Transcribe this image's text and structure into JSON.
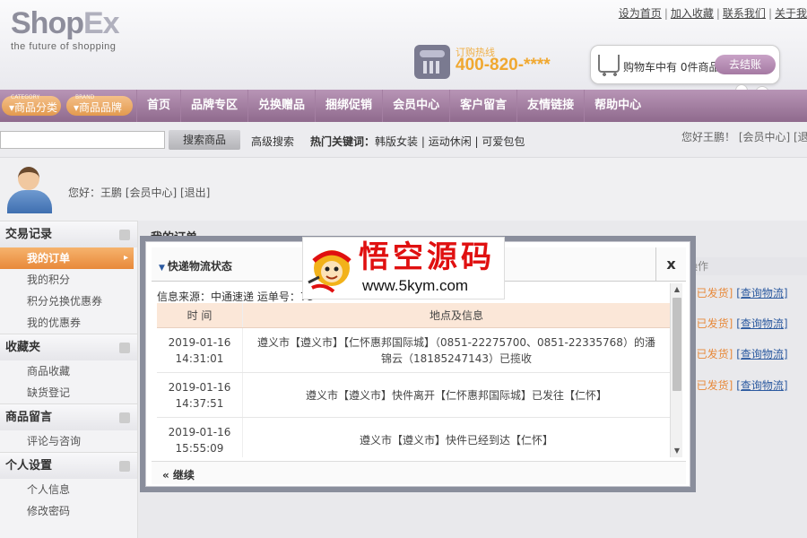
{
  "header": {
    "logo": {
      "main": "Shop",
      "accent": "Ex",
      "tagline": "the future of shopping"
    },
    "top_links": [
      "设为首页",
      "加入收藏",
      "联系我们",
      "关于我"
    ],
    "hotline": {
      "label": "订购热线",
      "number": "400-820-****"
    },
    "cart": {
      "text": "购物车中有 0件商品",
      "checkout": "去结账"
    }
  },
  "nav": {
    "category_pill": {
      "small": "CATEGORY",
      "label": "商品分类"
    },
    "brand_pill": {
      "small": "BRAND",
      "label": "商品品牌"
    },
    "items": [
      "首页",
      "品牌专区",
      "兑换赠品",
      "捆绑促销",
      "会员中心",
      "客户留言",
      "友情链接",
      "帮助中心"
    ]
  },
  "search": {
    "placeholder": "",
    "button": "搜索商品",
    "advanced": "高级搜索",
    "hot_label": "热门关键词：",
    "hot_keywords": "韩版女装 | 运动休闲 | 可爱包包",
    "greeting_right": "您好王鹏！ [会员中心]  [退"
  },
  "user": {
    "greeting": "您好：王鹏  [会员中心]  [退出]"
  },
  "sidebar": {
    "sections": [
      {
        "title": "交易记录",
        "items": [
          "我的订单",
          "我的积分",
          "积分兑换优惠券",
          "我的优惠券"
        ]
      },
      {
        "title": "收藏夹",
        "items": [
          "商品收藏",
          "缺货登记"
        ]
      },
      {
        "title": "商品留言",
        "items": [
          "评论与咨询"
        ]
      },
      {
        "title": "个人设置",
        "items": [
          "个人信息",
          "修改密码"
        ]
      }
    ]
  },
  "main": {
    "title": "我的订单",
    "strip_label": "操作",
    "orders": [
      {
        "status": "[已发货]",
        "link": "[查询物流]"
      },
      {
        "status": "[已发货]",
        "link": "[查询物流]"
      },
      {
        "status": "[已发货]",
        "link": "[查询物流]"
      },
      {
        "status": "[已发货]",
        "link": "[查询物流]"
      }
    ]
  },
  "modal": {
    "title": "快递物流状态",
    "close": "x",
    "info": "信息来源：中通速递 运单号：73",
    "columns": [
      "时 间",
      "地点及信息"
    ],
    "rows": [
      {
        "date": "2019-01-16",
        "time": "14:31:01",
        "info": "遵义市【遵义市】【仁怀惠邦国际城】（0851-22275700、0851-22335768）的潘锦云（18185247143）已揽收"
      },
      {
        "date": "2019-01-16",
        "time": "14:37:51",
        "info": "遵义市【遵义市】快件离开【仁怀惠邦国际城】已发往【仁怀】"
      },
      {
        "date": "2019-01-16",
        "time": "15:55:09",
        "info": "遵义市【遵义市】快件已经到达【仁怀】"
      }
    ],
    "continue": "« 继续"
  },
  "watermark": {
    "title": "悟空源码",
    "url": "www.5kym.com"
  },
  "colors": {
    "nav": "#9f7b9d",
    "accent_orange": "#e8893a",
    "link_blue": "#2c5aa0",
    "watermark_red": "#e01010"
  }
}
